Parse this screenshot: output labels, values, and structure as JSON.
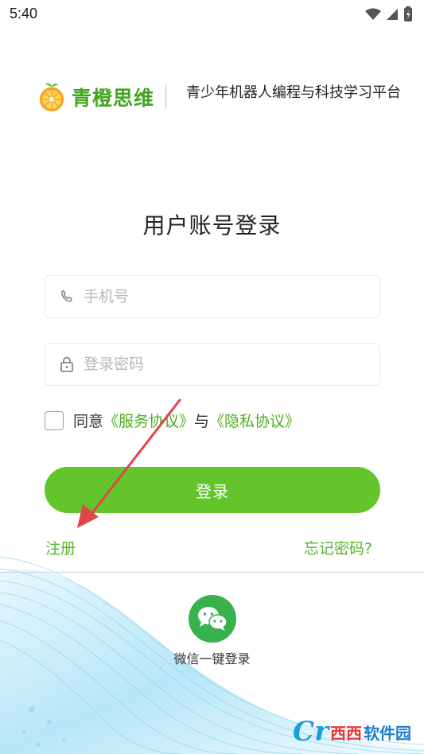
{
  "status_bar": {
    "time": "5:40"
  },
  "brand": {
    "name": "青橙思维",
    "slogan": "青少年机器人编程与科技学习平台"
  },
  "login": {
    "title": "用户账号登录",
    "phone_placeholder": "手机号",
    "password_placeholder": "登录密码",
    "agree_prefix": "同意",
    "service_link": "《服务协议》",
    "agree_and": "与",
    "privacy_link": "《隐私协议》",
    "submit_label": "登录",
    "register_label": "注册",
    "forgot_label": "忘记密码?"
  },
  "third_party": {
    "wechat_label": "微信一键登录"
  },
  "watermark": {
    "part_a": "西西",
    "part_b": "软件园"
  },
  "colors": {
    "brand_green": "#43a41f",
    "button_green": "#63c42b",
    "link_green": "#4cae21",
    "wechat_green": "#37b24d",
    "annotation_red": "#e0454b"
  }
}
